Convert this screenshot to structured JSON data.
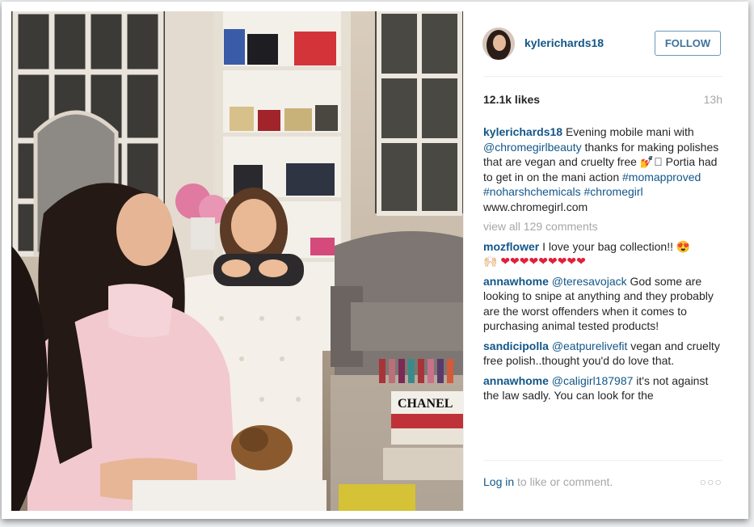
{
  "post": {
    "username": "kylerichards18",
    "follow_label": "FOLLOW",
    "likes": "12.1k likes",
    "time": "13h",
    "caption": {
      "username": "kylerichards18",
      "text_1": "Evening mobile mani with",
      "mention": "@chromegirlbeauty",
      "text_2": "thanks for making polishes that are vegan and cruelty free",
      "emoji": "💅\u0000",
      "text_3": "Portia had to get in on the mani action",
      "tag_1": "#momapproved",
      "tag_2": "#noharshchemicals",
      "tag_3": "#chromegirl",
      "text_4": "www.chromegirl.com"
    },
    "view_all": "view all 129 comments",
    "comments": [
      {
        "username": "mozflower",
        "text": "I love your bag collection!! 😍",
        "emoji_line": "🙌🏻 ❤❤❤❤❤❤❤❤❤"
      },
      {
        "username": "annawhome",
        "mention": "@teresavojack",
        "text": "God some are looking to snipe at anything and they probably are the worst offenders when it comes to purchasing animal tested products!"
      },
      {
        "username": "sandicipolla",
        "mention": "@eatpurelivefit",
        "text": "vegan and cruelty free polish..thought you'd do love that."
      },
      {
        "username": "annawhome",
        "mention": "@caligirl187987",
        "text": "it's not against the law sadly. You can look for the"
      }
    ],
    "login_label": "Log in",
    "login_suffix": "to like or comment.",
    "more": "○○○"
  },
  "photo": {
    "book_label": "CHANEL"
  },
  "colors": {
    "link": "#125688",
    "follow_border": "#6f97b6",
    "muted": "#a5a7aa",
    "text": "#262626"
  }
}
